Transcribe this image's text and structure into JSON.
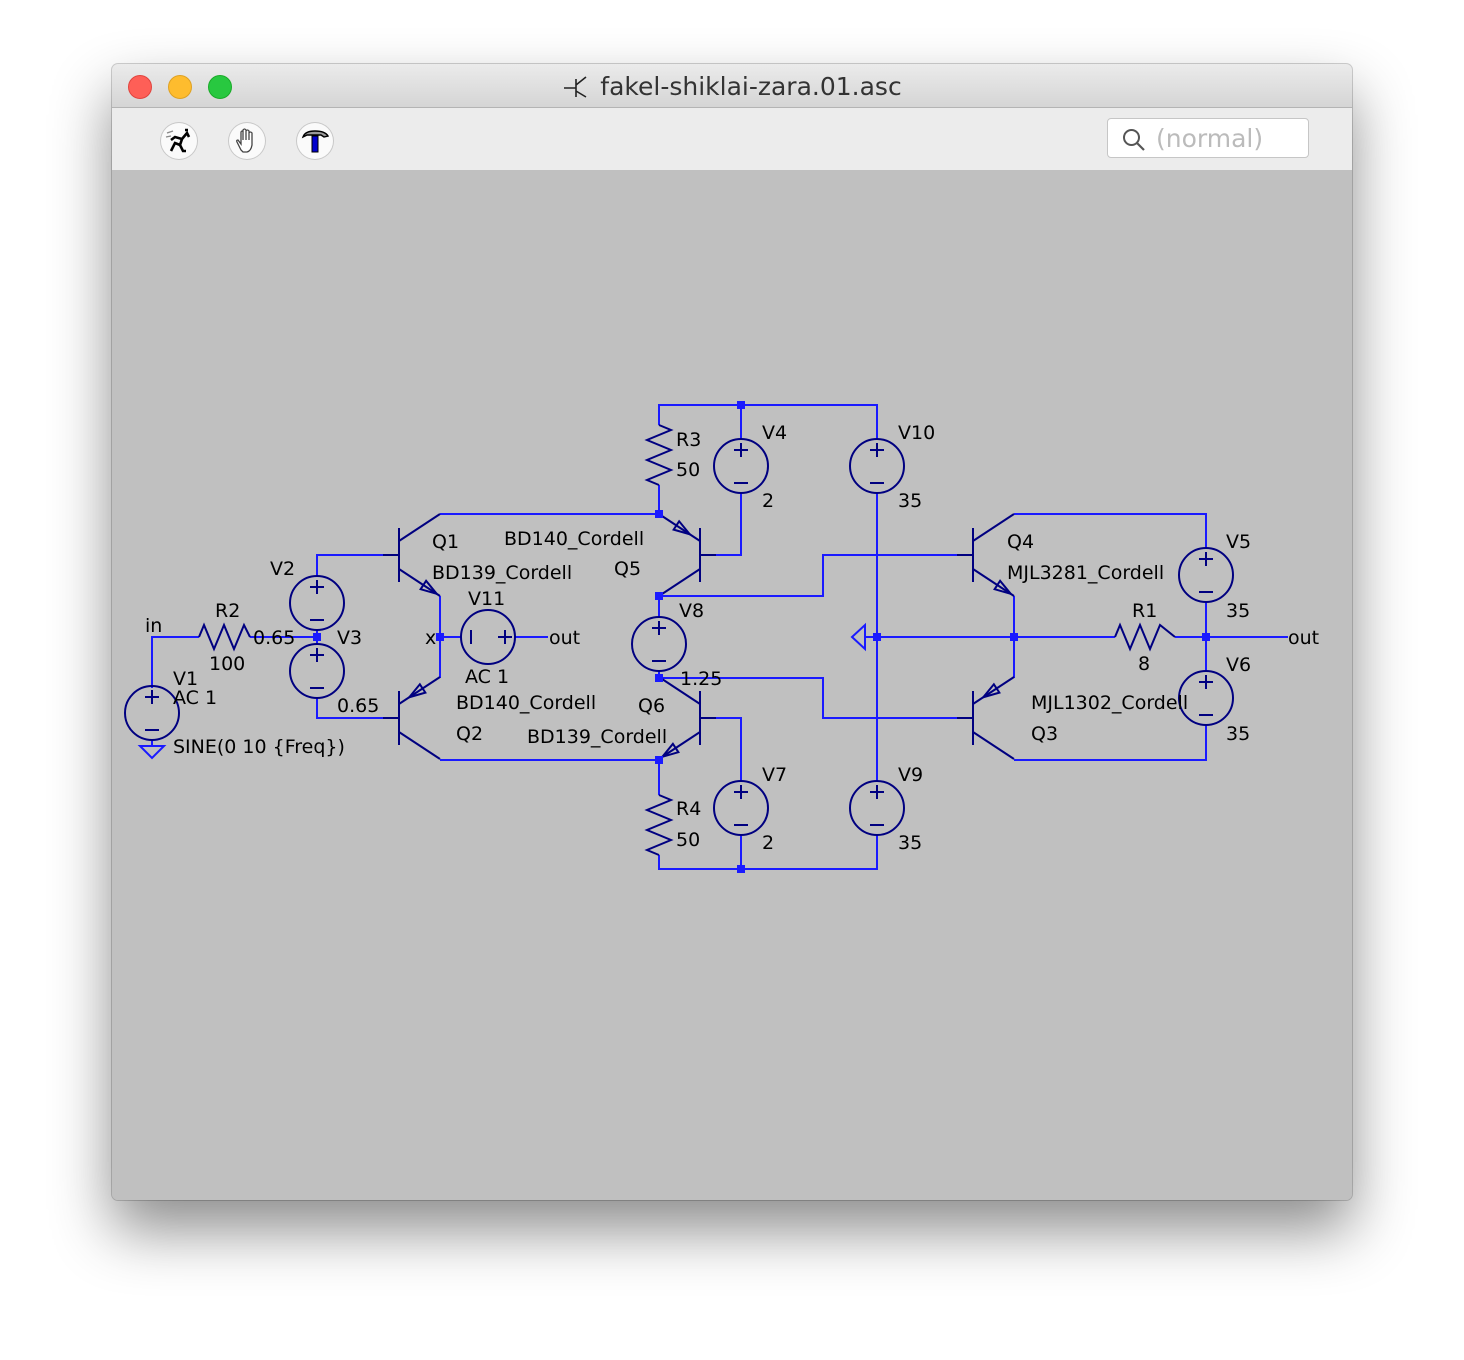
{
  "window": {
    "title": "fakel-shiklai-zara.01.asc",
    "traffic_lights": {
      "close": "#fe5f57",
      "minimize": "#febc2e",
      "zoom": "#28c840"
    }
  },
  "toolbar": {
    "buttons": [
      {
        "icon": "run-icon",
        "label": "Run"
      },
      {
        "icon": "hand-pan-icon",
        "label": "Pan"
      },
      {
        "icon": "hammer-icon",
        "label": "Edit"
      }
    ],
    "search": {
      "placeholder": "(normal)",
      "value": ""
    }
  },
  "colors": {
    "background": "#c0c0c0",
    "wire": "#1a1aff",
    "component": "#000080"
  },
  "schematic": {
    "nets": {
      "in": "in",
      "x": "x",
      "out1": "out",
      "out2": "out"
    },
    "resistors": [
      {
        "ref": "R1",
        "value": "8"
      },
      {
        "ref": "R2",
        "value": "100"
      },
      {
        "ref": "R3",
        "value": "50"
      },
      {
        "ref": "R4",
        "value": "50"
      }
    ],
    "sources": [
      {
        "ref": "V1",
        "value": "AC 1",
        "value2": "SINE(0 10 {Freq})"
      },
      {
        "ref": "V2",
        "value": "0.65"
      },
      {
        "ref": "V3",
        "value": "0.65"
      },
      {
        "ref": "V4",
        "value": "2"
      },
      {
        "ref": "V5",
        "value": "35"
      },
      {
        "ref": "V6",
        "value": "35"
      },
      {
        "ref": "V7",
        "value": "2"
      },
      {
        "ref": "V8",
        "value": "1.25"
      },
      {
        "ref": "V9",
        "value": "35"
      },
      {
        "ref": "V10",
        "value": "35"
      },
      {
        "ref": "V11",
        "value": "AC 1"
      }
    ],
    "transistors": [
      {
        "ref": "Q1",
        "model": "BD139_Cordell",
        "type": "npn"
      },
      {
        "ref": "Q2",
        "model": "BD140_Cordell",
        "type": "pnp"
      },
      {
        "ref": "Q3",
        "model": "MJL1302_Cordell",
        "type": "pnp"
      },
      {
        "ref": "Q4",
        "model": "MJL3281_Cordell",
        "type": "npn"
      },
      {
        "ref": "Q5",
        "model": "BD140_Cordell",
        "type": "pnp"
      },
      {
        "ref": "Q6",
        "model": "BD139_Cordell",
        "type": "npn"
      }
    ]
  }
}
